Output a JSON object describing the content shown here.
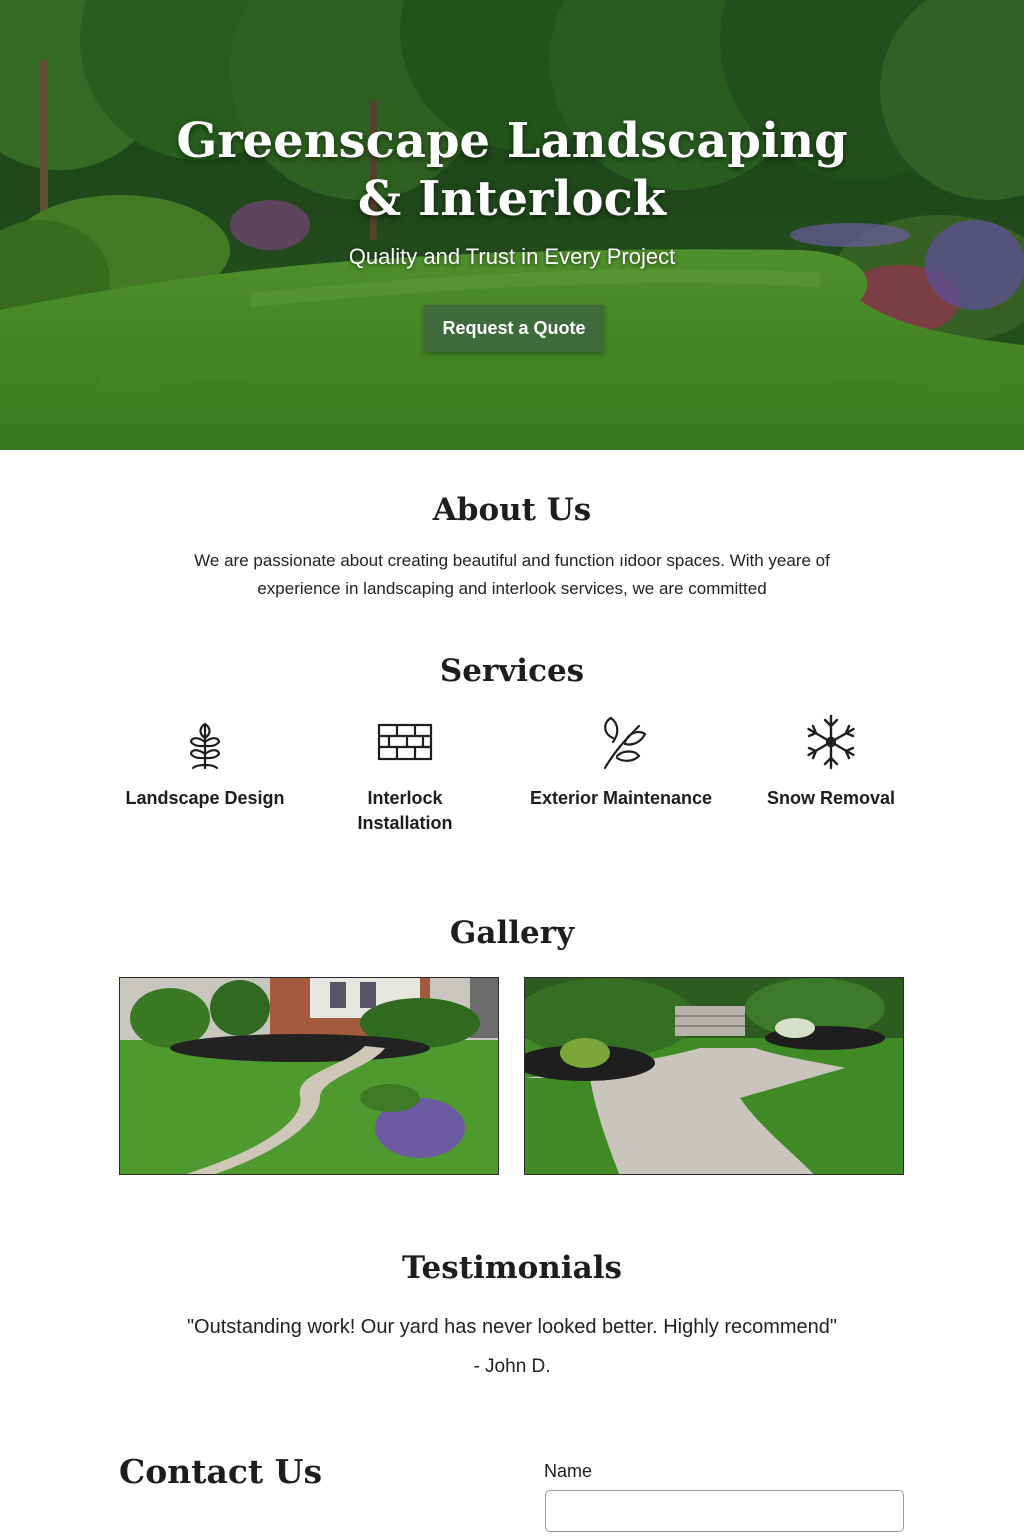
{
  "hero": {
    "title_line1": "Greenscape Landscaping",
    "title_line2": "& Interlock",
    "subtitle": "Quality and Trust in Every Project",
    "cta_label": "Request a Quote"
  },
  "about": {
    "title": "About Us",
    "text": "We are passionate about creating beautiful and function ıidoor spaces. With yeare of experience in landscaping and interlook services, we are committed"
  },
  "services": {
    "title": "Services",
    "items": [
      {
        "label": "Landscape Design",
        "icon": "plant-icon"
      },
      {
        "label": "Interlock Installation",
        "icon": "brick-icon"
      },
      {
        "label": "Exterior Maintenance",
        "icon": "leaves-icon"
      },
      {
        "label": "Snow Removal",
        "icon": "snowflake-icon"
      }
    ]
  },
  "gallery": {
    "title": "Gallery",
    "images": [
      "curved-paver-walkway",
      "stone-path-to-steps"
    ]
  },
  "testimonials": {
    "title": "Testimonials",
    "quote": "\"Outstanding work! Our yard has never looked better. Highly recommend\"",
    "author": "- John D."
  },
  "contact": {
    "title": "Contact Us",
    "name_label": "Name",
    "name_value": "",
    "name_placeholder": ""
  },
  "colors": {
    "accent": "#3f6b3c",
    "lawn": "#4f9a2f",
    "text": "#1d1d1d"
  }
}
